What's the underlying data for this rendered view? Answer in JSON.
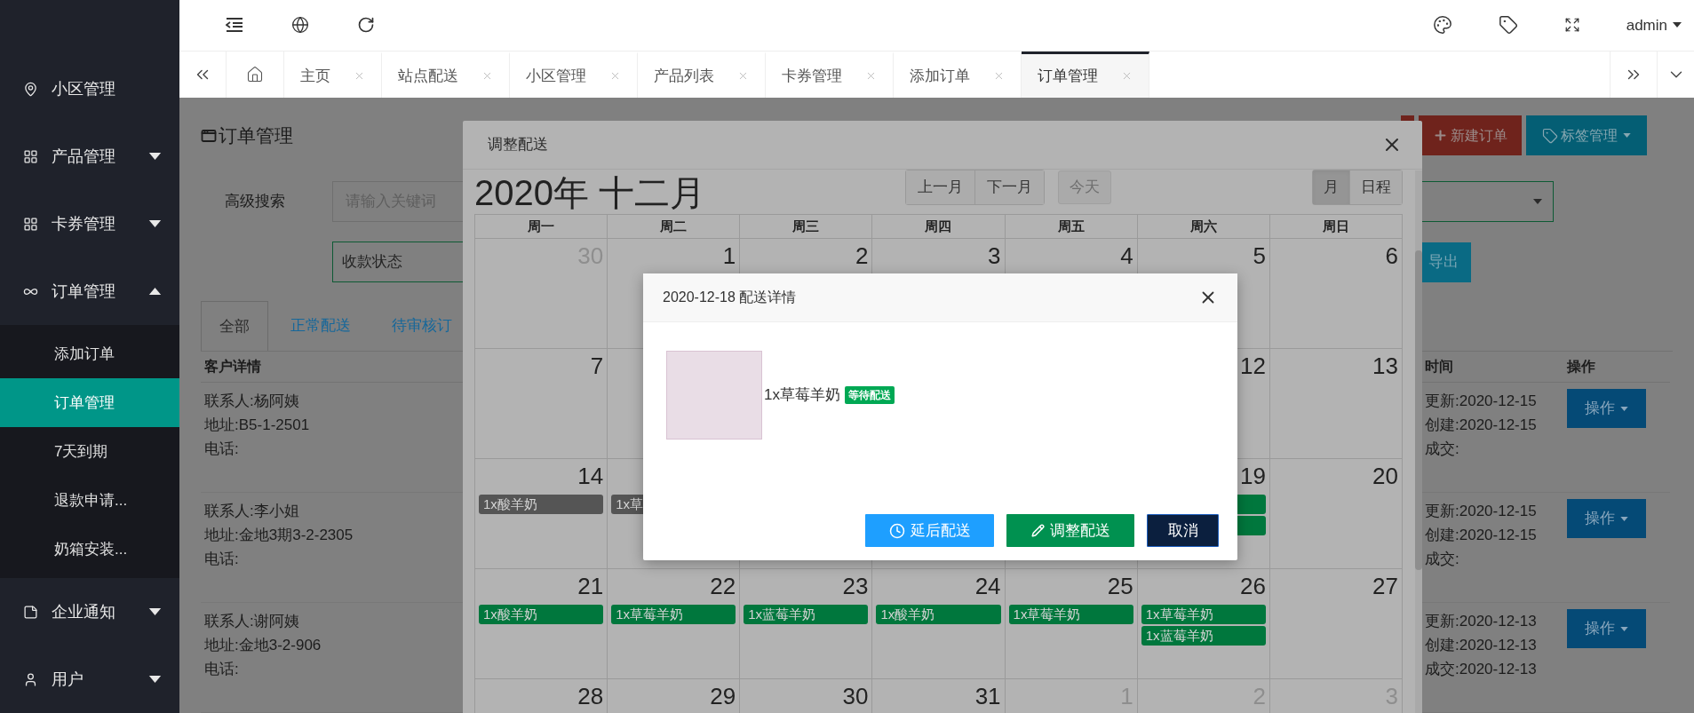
{
  "sidebar": {
    "items": [
      {
        "label": "小区管理"
      },
      {
        "label": "产品管理",
        "expanded": false
      },
      {
        "label": "卡券管理",
        "expanded": false
      },
      {
        "label": "订单管理",
        "expanded": true,
        "children": [
          {
            "label": "添加订单",
            "selected": false
          },
          {
            "label": "订单管理",
            "selected": true
          },
          {
            "label": "7天到期",
            "selected": false
          },
          {
            "label": "退款申请...",
            "selected": false
          },
          {
            "label": "奶箱安装...",
            "selected": false
          }
        ]
      },
      {
        "label": "企业通知",
        "expanded": false
      },
      {
        "label": "用户",
        "expanded": false
      }
    ]
  },
  "header": {
    "user": "admin"
  },
  "tabs": {
    "items": [
      {
        "label": "主页",
        "selected": false
      },
      {
        "label": "站点配送",
        "selected": false
      },
      {
        "label": "小区管理",
        "selected": false
      },
      {
        "label": "产品列表",
        "selected": false
      },
      {
        "label": "卡券管理",
        "selected": false
      },
      {
        "label": "添加订单",
        "selected": false
      },
      {
        "label": "订单管理",
        "selected": true
      }
    ]
  },
  "page": {
    "title": "订单管理",
    "actions": [
      {
        "label": "新建订单",
        "kind": "create"
      },
      {
        "label": "标签管理",
        "kind": "tags"
      }
    ],
    "search": {
      "label": "高级搜索",
      "placeholder": "请输入关键词"
    },
    "status_field": {
      "placeholder": "收款状态"
    },
    "export": "导出",
    "filter_tabs": [
      {
        "label": "全部",
        "selected": true
      },
      {
        "label": "正常配送",
        "selected": false
      },
      {
        "label": "待审核订",
        "selected": false
      }
    ],
    "table": {
      "columns": [
        "客户详情",
        "时间",
        "操作"
      ],
      "rows": [
        {
          "customer": [
            "联系人:杨阿姨",
            "地址:B5-1-2501",
            "电话:"
          ],
          "time": [
            "更新:2020-12-15",
            "创建:2020-12-15",
            "成交:"
          ],
          "action": "操作"
        },
        {
          "customer": [
            "联系人:李小姐",
            "地址:金地3期3-2-2305",
            "电话:"
          ],
          "time": [
            "更新:2020-12-15",
            "创建:2020-12-15",
            "成交:"
          ],
          "action": "操作"
        },
        {
          "customer": [
            "联系人:谢阿姨",
            "地址:金地3-2-906",
            "电话:"
          ],
          "time": [
            "更新:2020-12-13",
            "创建:2020-12-13",
            "成交:2020-12-13"
          ],
          "action": "操作"
        }
      ]
    }
  },
  "calendar_modal": {
    "title": "调整配送",
    "heading": "2020年 十二月",
    "nav": [
      "上一月",
      "下一月"
    ],
    "today": {
      "label": "今天",
      "disabled": true
    },
    "views": [
      {
        "label": "月",
        "selected": true
      },
      {
        "label": "日程",
        "selected": false
      }
    ],
    "weekdays": [
      "周一",
      "周二",
      "周三",
      "周四",
      "周五",
      "周六",
      "周日"
    ],
    "weeks": [
      {
        "mon": {
          "day": "30",
          "muted": true
        },
        "tue": {
          "day": "1",
          "muted": false
        },
        "wed": {
          "day": "2",
          "muted": false
        },
        "thu": {
          "day": "3",
          "muted": false
        },
        "fri": {
          "day": "4",
          "muted": false
        },
        "sat": {
          "day": "5",
          "muted": false
        },
        "sun": {
          "day": "6",
          "muted": false
        }
      },
      {
        "mon": {
          "day": "7",
          "muted": false
        },
        "sat": {
          "day": "12",
          "muted": false
        },
        "sun": {
          "day": "13",
          "muted": false
        }
      },
      {
        "mon": {
          "day": "14",
          "muted": false,
          "events": [
            {
              "label": "1x酸羊奶",
              "color": "#555555"
            }
          ]
        },
        "tue": {
          "events": [
            {
              "label": "1x草",
              "color": "#555555"
            }
          ]
        },
        "sat": {
          "day": "19",
          "muted": false,
          "events": [
            {
              "color": "#00773d"
            },
            {
              "color": "#00773d"
            }
          ]
        },
        "sun": {
          "day": "20",
          "muted": false
        }
      },
      {
        "mon": {
          "day": "21",
          "muted": false,
          "events": [
            {
              "label": "1x酸羊奶",
              "color": "#00773d"
            }
          ]
        },
        "tue": {
          "day": "22",
          "muted": false,
          "events": [
            {
              "label": "1x草莓羊奶",
              "color": "#00773d"
            }
          ]
        },
        "wed": {
          "day": "23",
          "muted": false,
          "events": [
            {
              "label": "1x蓝莓羊奶",
              "color": "#00773d"
            }
          ]
        },
        "thu": {
          "day": "24",
          "muted": false,
          "events": [
            {
              "label": "1x酸羊奶",
              "color": "#00773d"
            }
          ]
        },
        "fri": {
          "day": "25",
          "muted": false,
          "events": [
            {
              "label": "1x草莓羊奶",
              "color": "#00773d"
            }
          ]
        },
        "sat": {
          "day": "26",
          "muted": false,
          "events": [
            {
              "label": "1x草莓羊奶",
              "color": "#00773d"
            },
            {
              "label": "1x蓝莓羊奶",
              "color": "#00773d"
            }
          ]
        },
        "sun": {
          "day": "27",
          "muted": false
        }
      },
      {
        "mon": {
          "day": "28",
          "muted": false
        },
        "tue": {
          "day": "29",
          "muted": false
        },
        "wed": {
          "day": "30",
          "muted": false
        },
        "thu": {
          "day": "31",
          "muted": false
        },
        "fri": {
          "day": "1",
          "muted": true
        },
        "sat": {
          "day": "2",
          "muted": true
        },
        "sun": {
          "day": "3",
          "muted": true
        }
      }
    ]
  },
  "detail_dialog": {
    "title": "2020-12-18 配送详情",
    "items": [
      {
        "label": "1x草莓羊奶",
        "status": "等待配送"
      }
    ],
    "buttons": [
      {
        "label": "延后配送",
        "kind": "postpone"
      },
      {
        "label": "调整配送",
        "kind": "adjust"
      },
      {
        "label": "取消",
        "kind": "cancel"
      }
    ]
  }
}
